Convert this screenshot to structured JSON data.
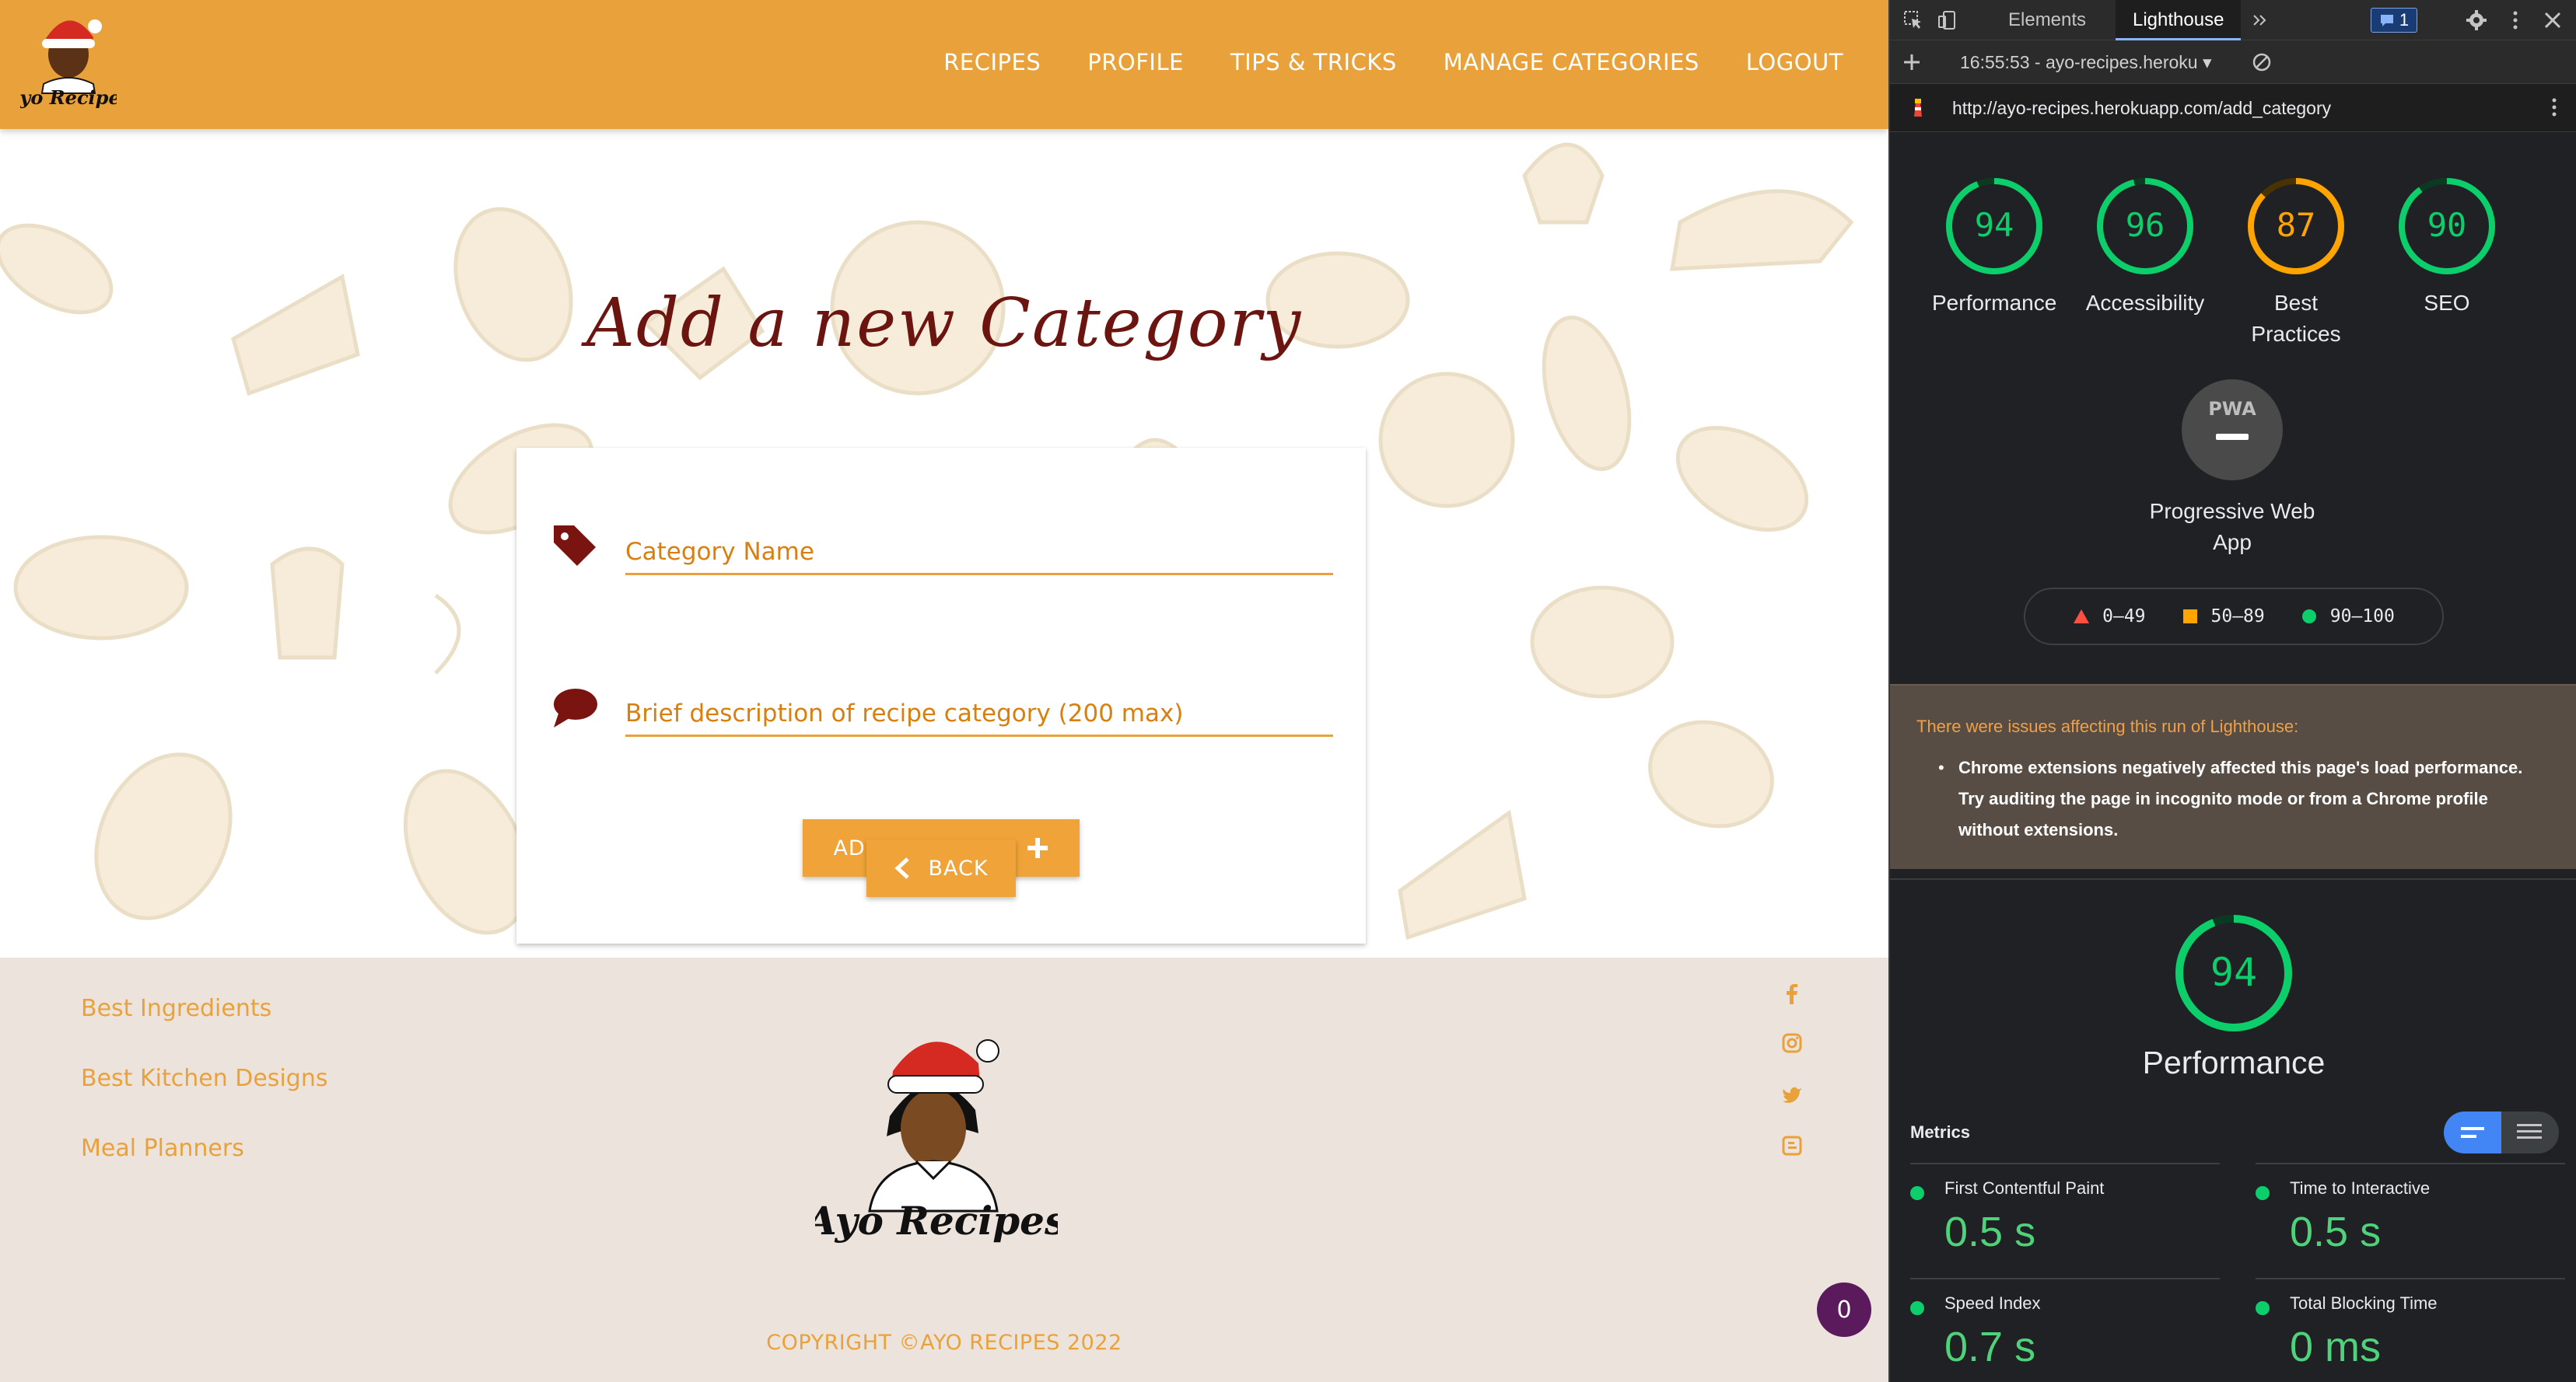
{
  "site": {
    "nav_links": [
      "RECIPES",
      "PROFILE",
      "TIPS & TRICKS",
      "MANAGE CATEGORIES",
      "LOGOUT"
    ],
    "page_title": "Add a new Category",
    "form": {
      "category_name_placeholder": "Category Name",
      "description_placeholder": "Brief description of recipe category (200 max)",
      "add_button_label": "ADD CATEGORY"
    },
    "back_button_label": "BACK",
    "footer": {
      "links": [
        "Best Ingredients",
        "Best Kitchen Designs",
        "Meal Planners"
      ],
      "logo_text": "Ayo Recipes",
      "social_icons": [
        "facebook-icon",
        "instagram-icon",
        "twitter-icon",
        "blogger-icon"
      ],
      "copyright": "COPYRIGHT ©AYO RECIPES 2022",
      "chat_badge_count": "0"
    },
    "colors": {
      "brand_orange": "#e9a23b",
      "title_maroon": "#6b1410",
      "footer_bg": "#ede3dd"
    }
  },
  "devtools": {
    "tabs": [
      "Elements",
      "Lighthouse"
    ],
    "active_tab": "Lighthouse",
    "issues_count": "1",
    "run_label": "16:55:53 - ayo-recipes.heroku",
    "url": "http://ayo-recipes.herokuapp.com/add_category",
    "scores": [
      {
        "label": "Performance",
        "value": 94,
        "color": "#0cce6b"
      },
      {
        "label": "Accessibility",
        "value": 96,
        "color": "#0cce6b"
      },
      {
        "label": "Best Practices",
        "value": 87,
        "color": "#ffa400"
      },
      {
        "label": "SEO",
        "value": 90,
        "color": "#0cce6b"
      }
    ],
    "pwa_label": "Progressive Web App",
    "pwa_logo": "PWA",
    "legend": [
      {
        "range": "0–49",
        "color": "#ff4e42",
        "shape": "triangle"
      },
      {
        "range": "50–89",
        "color": "#ffa400",
        "shape": "square"
      },
      {
        "range": "90–100",
        "color": "#0cce6b",
        "shape": "circle"
      }
    ],
    "warning_title": "There were issues affecting this run of Lighthouse:",
    "warning_body": "Chrome extensions negatively affected this page's load performance. Try auditing the page in incognito mode or from a Chrome profile without extensions.",
    "performance": {
      "score": 94,
      "title": "Performance",
      "metrics_label": "Metrics",
      "metrics": [
        {
          "name": "First Contentful Paint",
          "value": "0.5 s"
        },
        {
          "name": "Time to Interactive",
          "value": "0.5 s"
        },
        {
          "name": "Speed Index",
          "value": "0.7 s"
        },
        {
          "name": "Total Blocking Time",
          "value": "0 ms"
        }
      ]
    }
  }
}
